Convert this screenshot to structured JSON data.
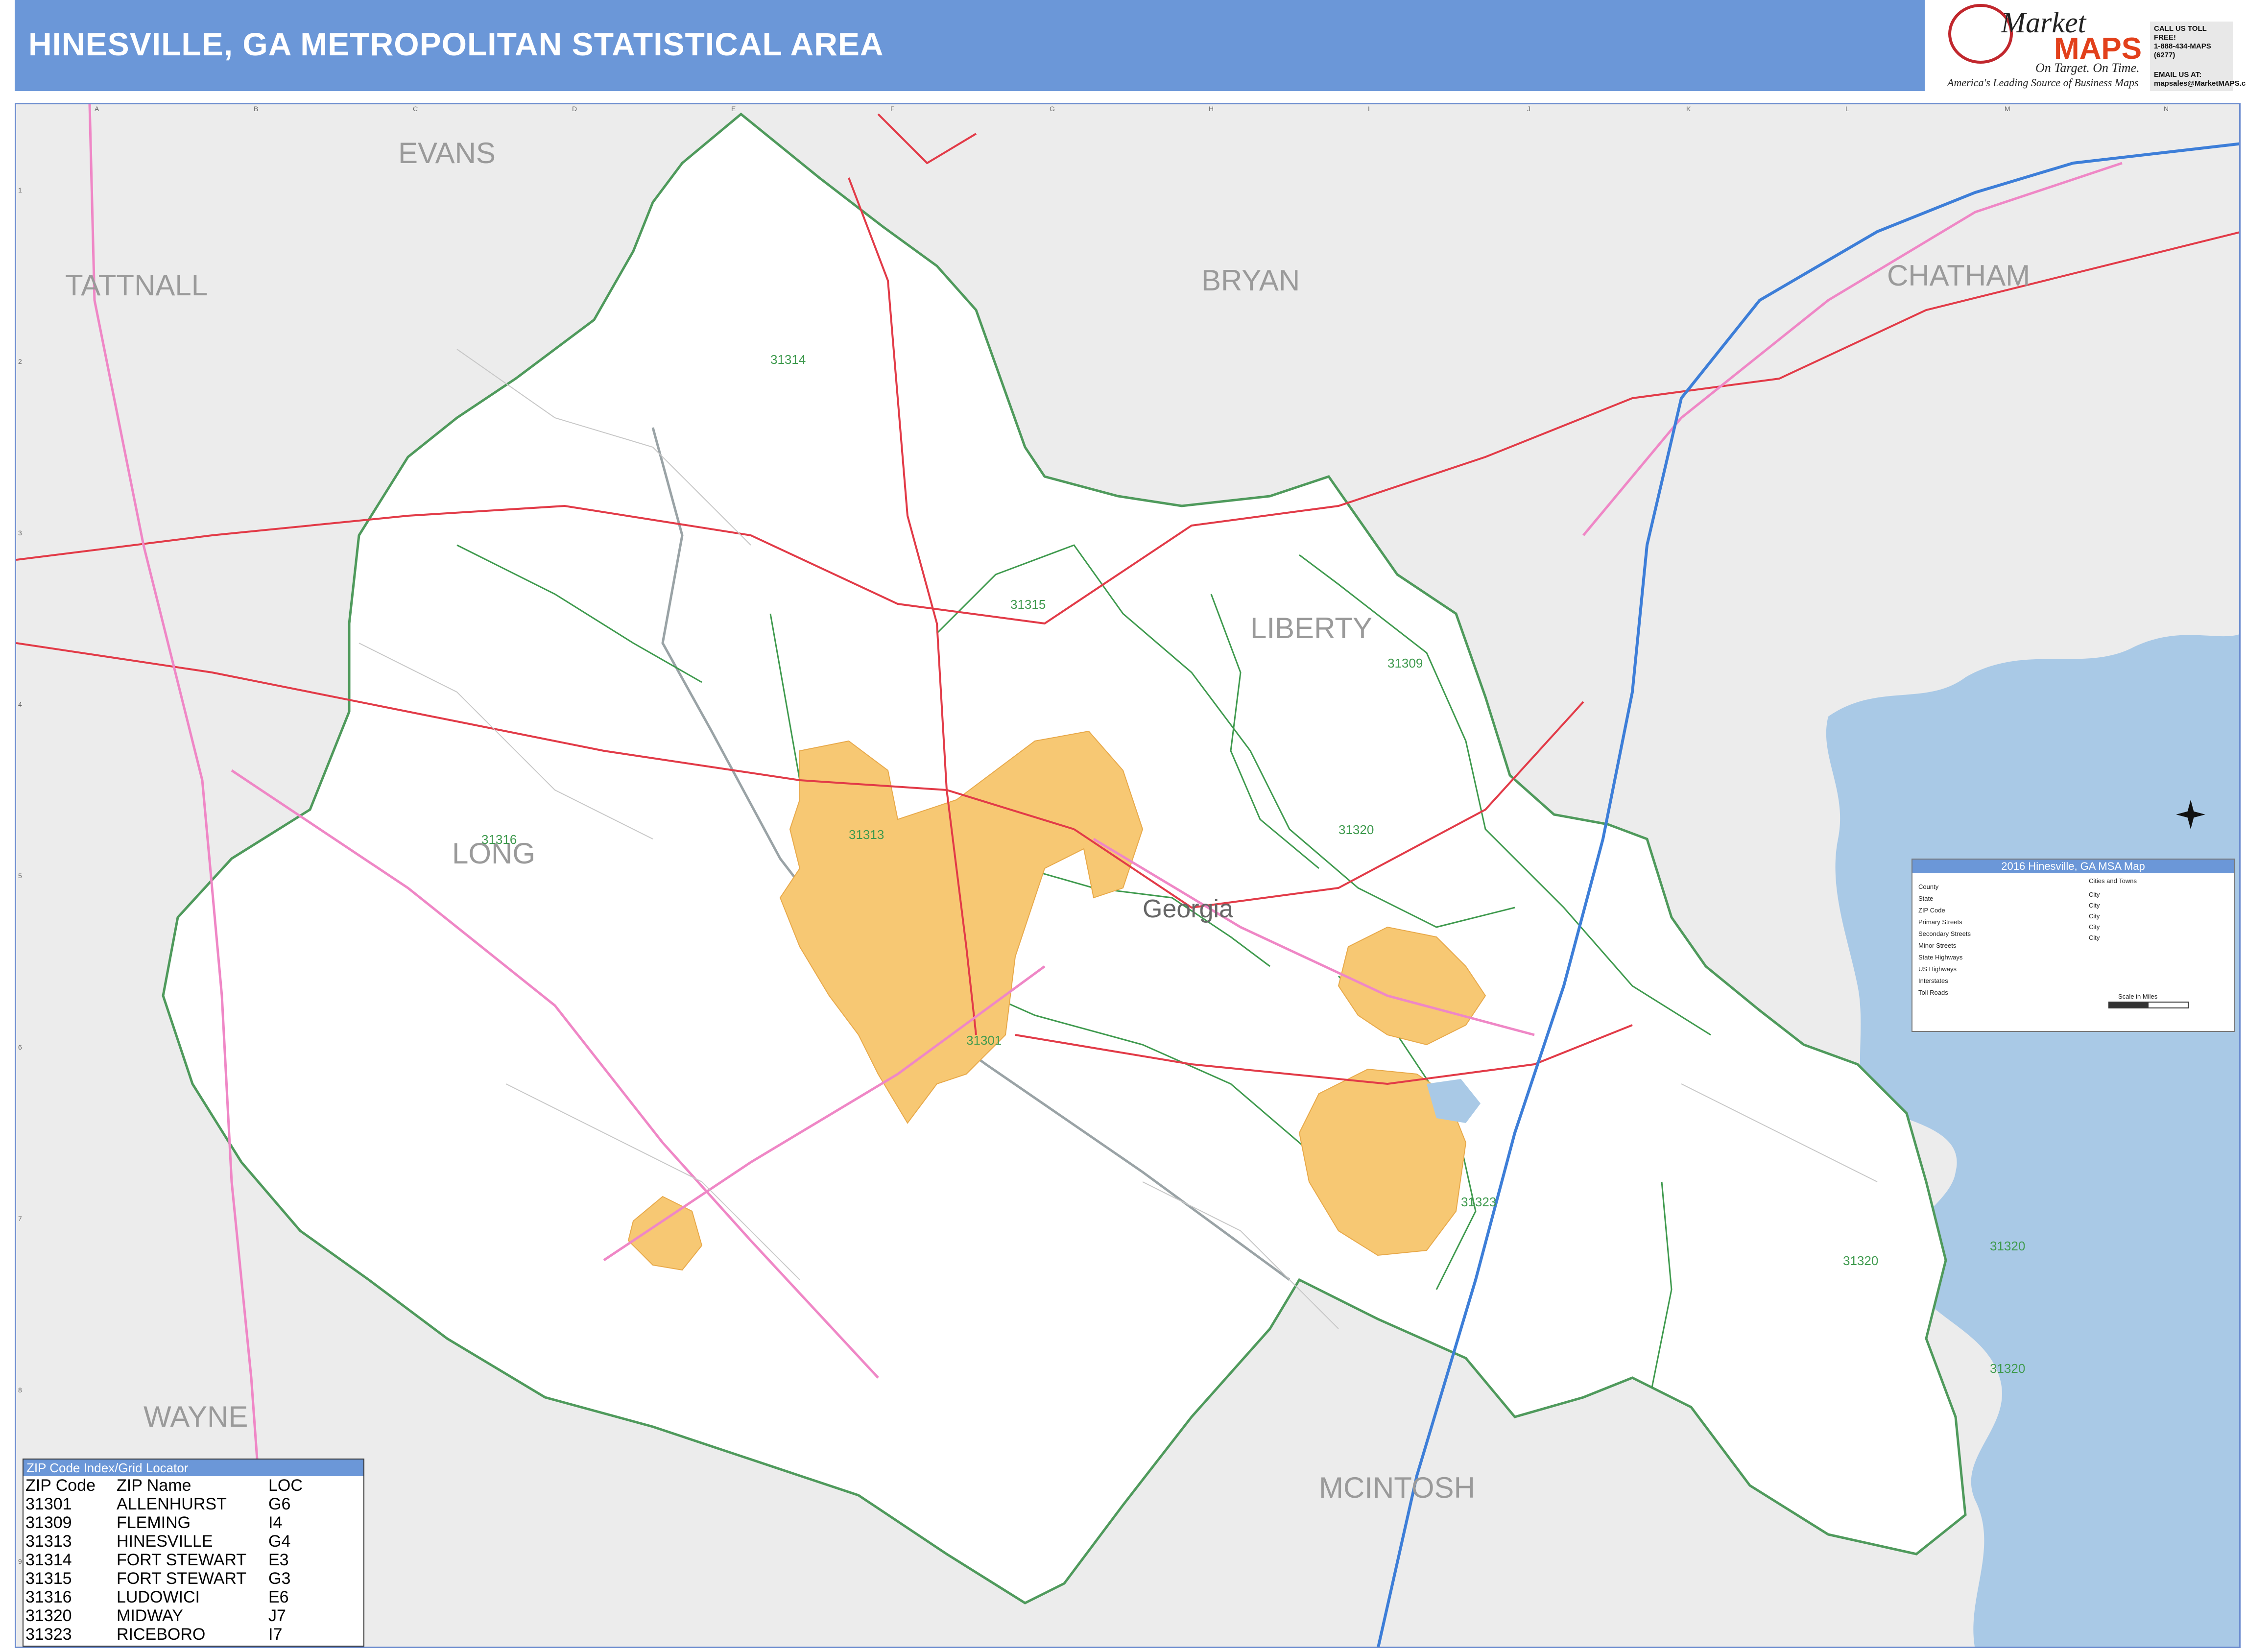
{
  "header": {
    "title": "HINESVILLE, GA METROPOLITAN STATISTICAL AREA"
  },
  "logo": {
    "brand_top": "Market",
    "brand_bottom": "MAPS",
    "tagline": "On Target. On Time.",
    "subtag": "America's Leading Source of Business Maps"
  },
  "contact": {
    "line1": "CALL US TOLL FREE!",
    "line2": "1-888-434-MAPS (6277)",
    "line3": "EMAIL US AT:",
    "line4": "mapsales@MarketMAPS.com"
  },
  "map": {
    "counties": {
      "evans": "EVANS",
      "tattnall": "TATTNALL",
      "bryan": "BRYAN",
      "chatham": "CHATHAM",
      "liberty": "LIBERTY",
      "long": "LONG",
      "wayne": "WAYNE",
      "mcintosh": "MCINTOSH"
    },
    "state": "Georgia",
    "zips": {
      "z31314": "31314",
      "z31315": "31315",
      "z31309": "31309",
      "z31313": "31313",
      "z31316": "31316",
      "z31320a": "31320",
      "z31301": "31301",
      "z31323": "31323",
      "z31320b": "31320",
      "z31320c": "31320",
      "z31320d": "31320"
    },
    "grid_cols": [
      "A",
      "B",
      "C",
      "D",
      "E",
      "F",
      "G",
      "H",
      "I",
      "J",
      "K",
      "L",
      "M",
      "N"
    ],
    "grid_rows": [
      "1",
      "2",
      "3",
      "4",
      "5",
      "6",
      "7",
      "8",
      "9"
    ],
    "colors": {
      "water": "#a9c9e6",
      "land": "#ffffff",
      "outside": "#ececec",
      "city": "#f7c873",
      "zip": "#3f9a4e",
      "state_hwy": "#e23b48",
      "us_hwy": "#ef87c6",
      "interstate": "#3d7ed8"
    }
  },
  "legend": {
    "title": "2016 Hinesville, GA MSA Map",
    "cities_header": "Cities and Towns",
    "rows": [
      "County",
      "State",
      "ZIP Code",
      "Primary Streets",
      "Secondary Streets",
      "Minor Streets",
      "State Highways",
      "US Highways",
      "Interstates",
      "Toll Roads"
    ],
    "city_sizes": [
      "City",
      "City",
      "City",
      "City",
      "City"
    ],
    "scale": "Scale in Miles"
  },
  "zip_index": {
    "title": "ZIP Code Index/Grid Locator",
    "headers": [
      "ZIP Code",
      "ZIP Name",
      "LOC"
    ],
    "rows": [
      [
        "31301",
        "ALLENHURST",
        "G6"
      ],
      [
        "31309",
        "FLEMING",
        "I4"
      ],
      [
        "31313",
        "HINESVILLE",
        "G4"
      ],
      [
        "31314",
        "FORT STEWART",
        "E3"
      ],
      [
        "31315",
        "FORT STEWART",
        "G3"
      ],
      [
        "31316",
        "LUDOWICI",
        "E6"
      ],
      [
        "31320",
        "MIDWAY",
        "J7"
      ],
      [
        "31323",
        "RICEBORO",
        "I7"
      ]
    ]
  }
}
